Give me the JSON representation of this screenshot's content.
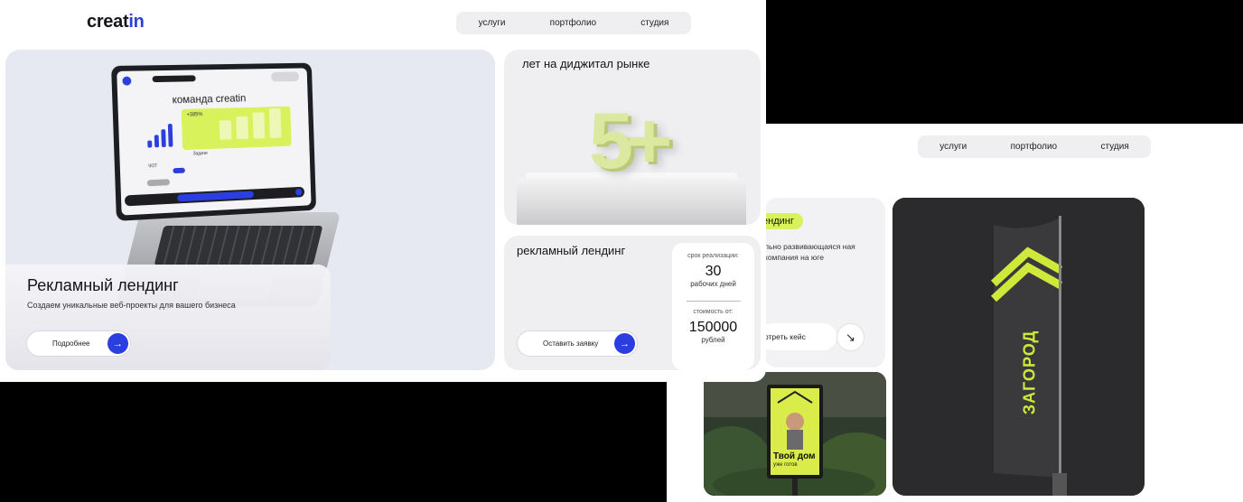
{
  "front": {
    "logo": {
      "main": "creat",
      "accent": "in"
    },
    "nav": [
      "услуги",
      "портфолио",
      "студия"
    ],
    "hero": {
      "title": "Рекламный лендинг",
      "subtitle": "Создаем уникальные веб-проекты для вашего бизнеса",
      "button_label": "Подробнее",
      "laptop_heading": "команда creatin",
      "laptop_percent": "+385%",
      "laptop_tasks": "Задачи",
      "laptop_report": "ЧОТ"
    },
    "years": {
      "title": "лет на диджитал рынке",
      "number": "5+"
    },
    "landing": {
      "title": "рекламный лендинг",
      "button_label": "Оставить заявку",
      "term_label": "срок реализации:",
      "term_value": "30",
      "term_unit": "рабочих дней",
      "cost_label": "стоимость от:",
      "cost_value": "150000",
      "cost_unit": "рублей"
    }
  },
  "back": {
    "nav": [
      "услуги",
      "портфолио",
      "студия"
    ],
    "tag": "ендинг",
    "desc": "льно развивающаяся ная компания на юге",
    "case_button": "отреть кейс",
    "flag_text": "ЗАГОРОД",
    "poster_title": "Твой дом",
    "poster_sub": "уже готов"
  },
  "colors": {
    "accent_blue": "#2b3fe0",
    "lime": "#d7f25a",
    "card_bg": "#efeff2"
  }
}
